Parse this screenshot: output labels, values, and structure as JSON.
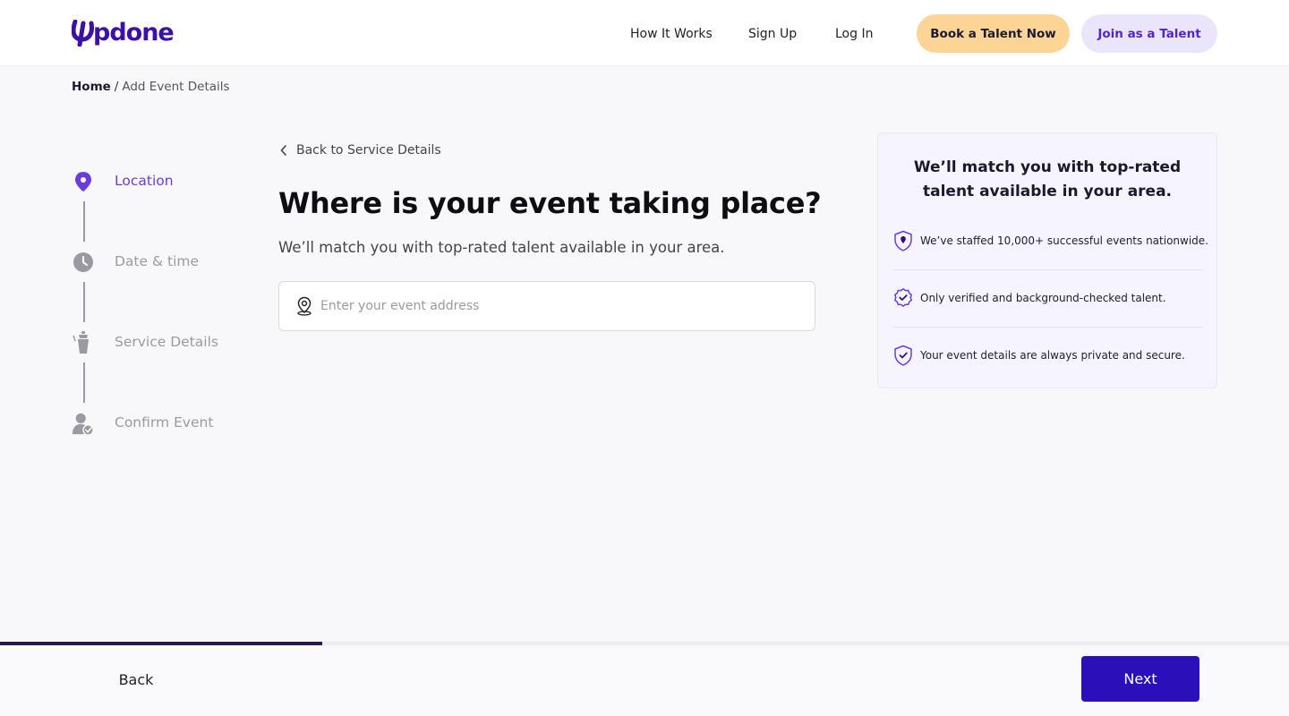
{
  "header": {
    "logo_text": "pdone",
    "nav": [
      "How It Works",
      "Sign Up",
      "Log In"
    ],
    "book_label": "Book a Talent Now",
    "join_label": "Join as a Talent"
  },
  "breadcrumb": {
    "home": "Home",
    "separator": "/",
    "current": "Add Event Details"
  },
  "steps": [
    {
      "label": "Location",
      "icon": "map-pin-icon",
      "active": true
    },
    {
      "label": "Date & time",
      "icon": "clock-icon",
      "active": false
    },
    {
      "label": "Service Details",
      "icon": "cocktail-shaker-icon",
      "active": false
    },
    {
      "label": "Confirm Event",
      "icon": "user-check-icon",
      "active": false
    }
  ],
  "main": {
    "back_link": "Back to Service Details",
    "title": "Where is your event taking place?",
    "subtitle": "We’ll match you with top-rated talent available in your area.",
    "address_placeholder": "Enter your event address",
    "address_value": ""
  },
  "card": {
    "title_line1": "We’ll match you with top-rated",
    "title_line2": "talent available in your area.",
    "features": [
      {
        "text": "We’ve staffed 10,000+ successful events nationwide.",
        "icon": "shield-pin-icon"
      },
      {
        "text": "Only verified and background-checked talent.",
        "icon": "verified-badge-icon"
      },
      {
        "text": "Your event details are always private and secure.",
        "icon": "shield-check-icon"
      }
    ]
  },
  "footer": {
    "back_label": "Back",
    "next_label": "Next",
    "progress": 0.25
  },
  "colors": {
    "accent": "#6a3ce0",
    "brand": "#3c11a8",
    "primary_button": "#2b0fb8",
    "book_button": "#fcd496",
    "join_button": "#ebe5fc"
  }
}
